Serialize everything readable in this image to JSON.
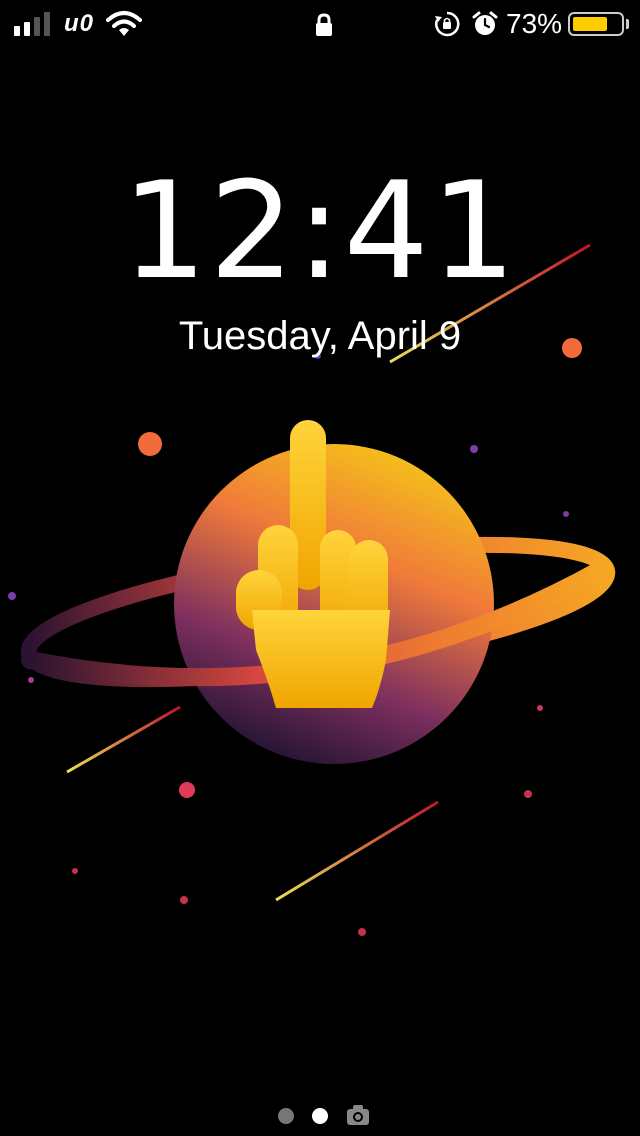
{
  "status_bar": {
    "carrier": "u0",
    "battery_percent_label": "73%",
    "battery_level": 0.73,
    "signal_bars_filled": 2,
    "signal_bars_total": 4,
    "icons": [
      "signal-icon",
      "wifi-icon",
      "lock-icon",
      "orientation-lock-icon",
      "alarm-icon",
      "battery-icon"
    ],
    "battery_color": "#ffcc00"
  },
  "lockscreen": {
    "time": "12:41",
    "date": "Tuesday, April 9"
  },
  "wallpaper": {
    "description_icon": "planet-wallpaper",
    "emoji": "middle-finger-emoji"
  },
  "page_indicator": {
    "pages": 2,
    "current_page": 2,
    "camera_icon": "camera-icon"
  }
}
